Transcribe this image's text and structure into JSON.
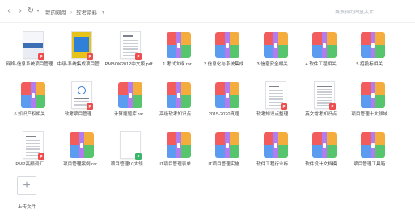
{
  "nav": {
    "back_icon": "chevron-left-icon",
    "forward_icon": "chevron-right-icon",
    "refresh_icon": "refresh-icon",
    "breadcrumb": [
      "我的网盘",
      "软考资料"
    ],
    "separator": "›"
  },
  "search": {
    "placeholder": "搜索我的网盘文件",
    "value": ""
  },
  "files": [
    {
      "name": "网络-信息系统项目管理...",
      "type": "doc",
      "variant": "cover-a",
      "badge": "pdf"
    },
    {
      "name": "中级-系统集成项目管...",
      "type": "doc",
      "variant": "cover-b",
      "badge": "pdf"
    },
    {
      "name": "PMBOK2012中文版.pdf",
      "type": "doc",
      "variant": "text",
      "badge": "pdf"
    },
    {
      "name": "1.考试大纲.rar",
      "type": "rar"
    },
    {
      "name": "2.信息化与系统集成...",
      "type": "rar"
    },
    {
      "name": "3.信息安全相关...",
      "type": "rar"
    },
    {
      "name": "4.软件工程相关...",
      "type": "rar"
    },
    {
      "name": "5.招投标相关...",
      "type": "rar"
    },
    {
      "name": "6.知识产权相关...",
      "type": "rar"
    },
    {
      "name": "软考项目管理...",
      "type": "doc",
      "variant": "logo",
      "badge": "pdf"
    },
    {
      "name": "计算题题库.rar",
      "type": "rar"
    },
    {
      "name": "高级软考知识点...",
      "type": "rar"
    },
    {
      "name": "2015-2020真题...",
      "type": "rar"
    },
    {
      "name": "软考知识点整理...",
      "type": "doc",
      "variant": "text",
      "badge": "pdf"
    },
    {
      "name": "英文常考知识点...",
      "type": "doc",
      "variant": "table",
      "badge": "pdf"
    },
    {
      "name": "项目管理十大领域...",
      "type": "rar"
    },
    {
      "name": "PMP高频词汇...",
      "type": "doc",
      "variant": "text",
      "badge": "pdf"
    },
    {
      "name": "项目管理案例.rar",
      "type": "rar"
    },
    {
      "name": "项目管理10大领...",
      "type": "doc",
      "variant": "blank",
      "badge": "xls"
    },
    {
      "name": "IT项目管理表单...",
      "type": "rar"
    },
    {
      "name": "IT项目管理实施...",
      "type": "rar"
    },
    {
      "name": "软件工程行业标...",
      "type": "rar"
    },
    {
      "name": "软件设计文档模...",
      "type": "rar"
    },
    {
      "name": "项目管理工具箱...",
      "type": "rar"
    }
  ],
  "upload": {
    "label": "上传文件",
    "icon": "plus-icon"
  },
  "colors": {
    "accent": "#3a7bd5",
    "pdf_badge": "#ef4d4d",
    "xls_badge": "#3bb56b"
  }
}
